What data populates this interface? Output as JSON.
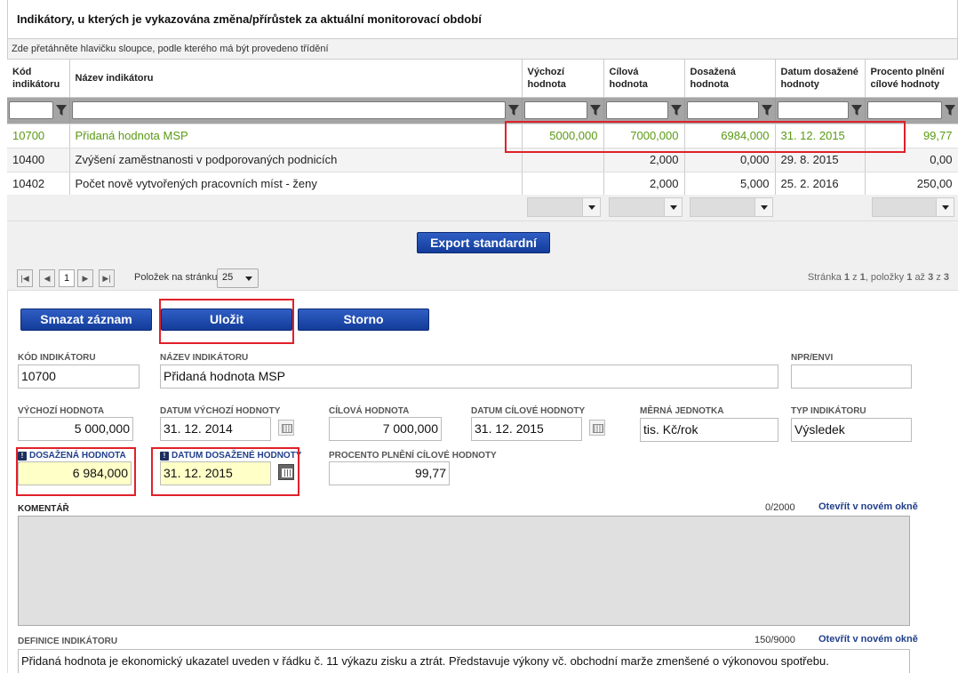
{
  "title": "Indikátory, u kterých je vykazována změna/přírůstek za aktuální monitorovací období",
  "drag_hint": "Zde přetáhněte hlavičku sloupce, podle kterého má být provedeno třídění",
  "columns": [
    "Kód indikátoru",
    "Název indikátoru",
    "Výchozí hodnota",
    "Cílová hodnota",
    "Dosažená hodnota",
    "Datum dosažené hodnoty",
    "Procento plnění cílové hodnoty"
  ],
  "rows": [
    {
      "kod": "10700",
      "nazev": "Přidaná hodnota MSP",
      "vychozi": "5000,000",
      "cilova": "7000,000",
      "dosazena": "6984,000",
      "datum": "31. 12. 2015",
      "procento": "99,77"
    },
    {
      "kod": "10400",
      "nazev": "Zvýšení zaměstnanosti v podporovaných podnicích",
      "vychozi": "",
      "cilova": "2,000",
      "dosazena": "0,000",
      "datum": "29. 8. 2015",
      "procento": "0,00"
    },
    {
      "kod": "10402",
      "nazev": "Počet nově vytvořených pracovních míst - ženy",
      "vychozi": "",
      "cilova": "2,000",
      "dosazena": "5,000",
      "datum": "25. 2. 2016",
      "procento": "250,00"
    }
  ],
  "export_label": "Export standardní",
  "pager": {
    "current_page": "1",
    "per_page_label": "Položek na stránku",
    "per_page_value": "25",
    "info_prefix": "Stránka",
    "info_page": "1",
    "info_z": "z",
    "info_pages": "1",
    "info_items": ", položky",
    "info_from": "1",
    "info_az": "až",
    "info_to": "3",
    "info_z2": "z",
    "info_total": "3"
  },
  "buttons": {
    "delete": "Smazat záznam",
    "save": "Uložit",
    "cancel": "Storno"
  },
  "form": {
    "kod_label": "Kód indikátoru",
    "kod_value": "10700",
    "nazev_label": "Název indikátoru",
    "nazev_value": "Přidaná hodnota MSP",
    "npr_label": "NPR/ENVI",
    "npr_value": "",
    "vychozi_label": "Výchozí hodnota",
    "vychozi_value": "5 000,000",
    "datum_vychozi_label": "Datum výchozí hodnoty",
    "datum_vychozi_value": "31. 12. 2014",
    "cilova_label": "Cílová hodnota",
    "cilova_value": "7 000,000",
    "datum_cilove_label": "Datum cílové hodnoty",
    "datum_cilove_value": "31. 12. 2015",
    "jednotka_label": "Měrná jednotka",
    "jednotka_value": "tis. Kč/rok",
    "typ_label": "Typ indikátoru",
    "typ_value": "Výsledek",
    "dosazena_label": "Dosažená hodnota",
    "dosazena_value": "6 984,000",
    "datum_dosazene_label": "Datum dosažené hodnoty",
    "datum_dosazene_value": "31. 12. 2015",
    "procento_label": "Procento plnění cílové hodnoty",
    "procento_value": "99,77",
    "komentar_label": "Komentář",
    "komentar_count": "0/2000",
    "definice_label": "Definice indikátoru",
    "definice_count": "150/9000",
    "definice_value": "Přidaná hodnota je ekonomický ukazatel uveden v řádku č. 11 výkazu zisku a ztrát. Představuje výkony vč. obchodní marže zmenšené o výkonovou spotřebu.",
    "open_new_window": "Otevřít v novém okně",
    "required_marker": "!"
  },
  "colors": {
    "accent_blue": "#1d47a8",
    "selected_green": "#5a9a14",
    "highlight_red": "#e0202a",
    "required_yellow": "#ffffc8"
  }
}
